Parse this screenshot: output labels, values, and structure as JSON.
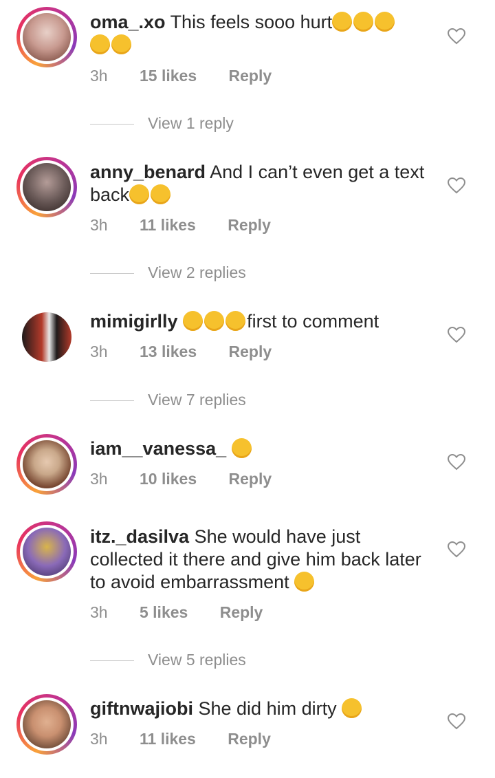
{
  "comments": [
    {
      "username": "oma_.xo",
      "text": "This feels sooo hurt",
      "emoji": [
        "relieved-face",
        "relieved-face",
        "relieved-face",
        "relieved-face",
        "relieved-face"
      ],
      "time": "3h",
      "likes": "15 likes",
      "reply": "Reply",
      "view_replies": "View 1 reply",
      "avatar_colors": [
        "#e8d0c8",
        "#6b3a2e"
      ]
    },
    {
      "username": "anny_benard",
      "text": "And I can’t even get a text back",
      "emoji": [
        "weary-face",
        "weary-face"
      ],
      "time": "3h",
      "likes": "11 likes",
      "reply": "Reply",
      "view_replies": "View 2 replies",
      "avatar_colors": [
        "#6a5a58",
        "#2a1e1c"
      ]
    },
    {
      "username": "mimigirlly",
      "text": "first to comment",
      "emoji": [
        "tears-of-joy-face",
        "tears-of-joy-face",
        "tears-of-joy-face"
      ],
      "time": "3h",
      "likes": "13 likes",
      "reply": "Reply",
      "view_replies": "View 7 replies",
      "avatar_colors": [
        "#b33a2a",
        "#1e1a1a"
      ]
    },
    {
      "username": "iam__vanessa_",
      "text": "",
      "emoji": [
        "weary-face"
      ],
      "time": "3h",
      "likes": "10 likes",
      "reply": "Reply",
      "view_replies": "",
      "avatar_colors": [
        "#c9a88a",
        "#4a2a1e"
      ]
    },
    {
      "username": "itz._dasilva",
      "text": "She would have just collected it there and give him back later to avoid embarrassment",
      "emoji": [
        "tears-of-joy-face"
      ],
      "time": "3h",
      "likes": "5 likes",
      "reply": "Reply",
      "view_replies": "View 5 replies",
      "avatar_colors": [
        "#8a6ab8",
        "#d9b54a"
      ]
    },
    {
      "username": "giftnwajiobi",
      "text": "She did him dirty",
      "emoji": [
        "crying-face"
      ],
      "time": "3h",
      "likes": "11 likes",
      "reply": "Reply",
      "view_replies": "",
      "avatar_colors": [
        "#c99070",
        "#3a2418"
      ]
    }
  ],
  "icons": {
    "like": "heart-outline-icon"
  },
  "colors": {
    "meta": "#8e8e8e",
    "text": "#262626",
    "ring_start": "#f9a23a",
    "ring_end": "#8a3ab9"
  }
}
